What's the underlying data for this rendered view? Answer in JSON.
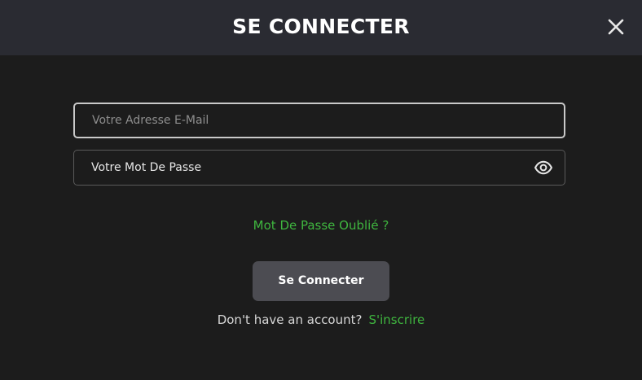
{
  "header": {
    "title": "SE CONNECTER",
    "close_icon": "close-icon",
    "background": "#2a2b32"
  },
  "form": {
    "email": {
      "placeholder": "Votre Adresse E-Mail",
      "value": ""
    },
    "password": {
      "placeholder": "Votre Mot De Passe",
      "value": "",
      "toggle_icon": "eye-icon"
    },
    "forgot_password_label": "Mot De Passe Oublié ?",
    "submit_label": "Se Connecter",
    "signup_prompt": "Don't have an account?",
    "signup_label": "S'inscrire"
  },
  "colors": {
    "accent": "#3fb63f",
    "background": "#1c1c1c",
    "button": "#4c4c52"
  }
}
